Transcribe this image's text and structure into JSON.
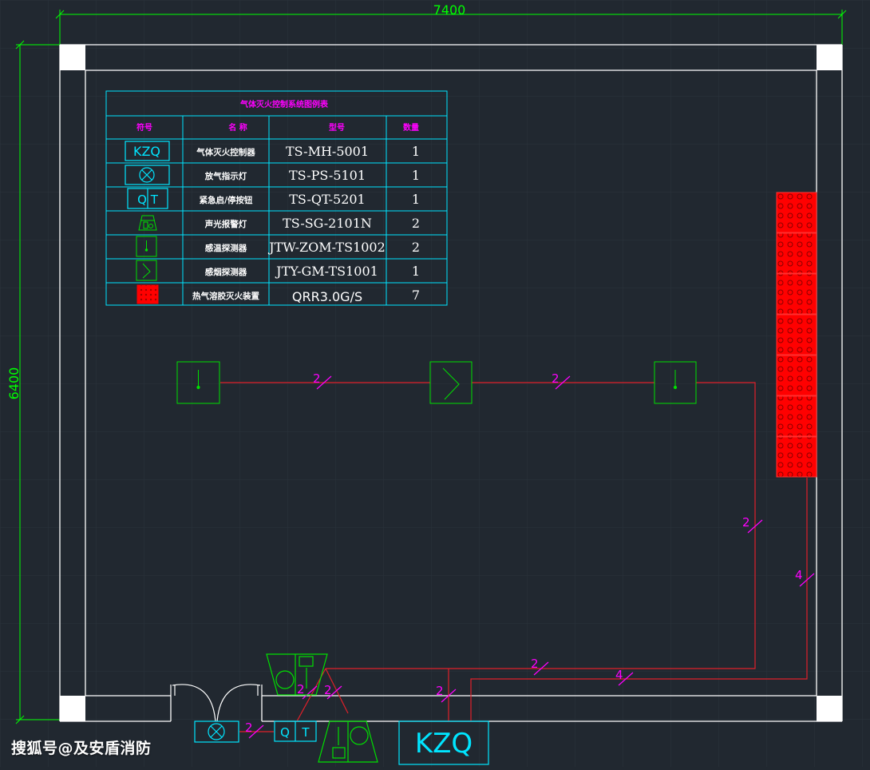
{
  "dimensions": {
    "width": "7400",
    "height": "6400"
  },
  "legend": {
    "title": "气体灭火控制系统图例表",
    "headers": [
      "符号",
      "名 称",
      "型号",
      "数量"
    ],
    "rows": [
      {
        "symbol_text": "KZQ",
        "icon": "kzq-controller-icon",
        "name": "气体灭火控制器",
        "model": "TS-MH-5001",
        "qty": "1"
      },
      {
        "symbol_text": "",
        "icon": "release-indicator-lamp-icon",
        "name": "放气指示灯",
        "model": "TS-PS-5101",
        "qty": "1"
      },
      {
        "symbol_text": "Q T",
        "icon": "emergency-start-stop-button-icon",
        "name": "紧急启/停按钮",
        "model": "TS-QT-5201",
        "qty": "1"
      },
      {
        "symbol_text": "",
        "icon": "sound-light-alarm-icon",
        "name": "声光报警灯",
        "model": "TS-SG-2101N",
        "qty": "2"
      },
      {
        "symbol_text": "",
        "icon": "smoke-detector-icon",
        "name": "感温探测器",
        "model": "JTW-ZOM-TS1002",
        "qty": "2"
      },
      {
        "symbol_text": "",
        "icon": "heat-detector-icon",
        "name": "感烟探测器",
        "model": "JTY-GM-TS1001",
        "qty": "1"
      },
      {
        "symbol_text": "",
        "icon": "gas-extinguisher-device-icon",
        "name": "热气溶胶灭火装置",
        "model": "QRR3.0G/S",
        "qty": "7"
      }
    ]
  },
  "wire_labels": {
    "two": "2",
    "four": "4"
  },
  "devices": {
    "kzq_label": "KZQ",
    "qt_q": "Q",
    "qt_t": "T"
  },
  "watermark": "搜狐号@及安盾消防",
  "colors": {
    "background": "#212830",
    "wall": "#ffffff",
    "dimension": "#00ff00",
    "legend_line": "#00e5ff",
    "legend_header": "#ff00ff",
    "wire": "#e0202a",
    "wire_label": "#ff00ff",
    "device_green": "#00e000",
    "device_cyan": "#00e5ff",
    "extinguisher": "#ff0000"
  }
}
